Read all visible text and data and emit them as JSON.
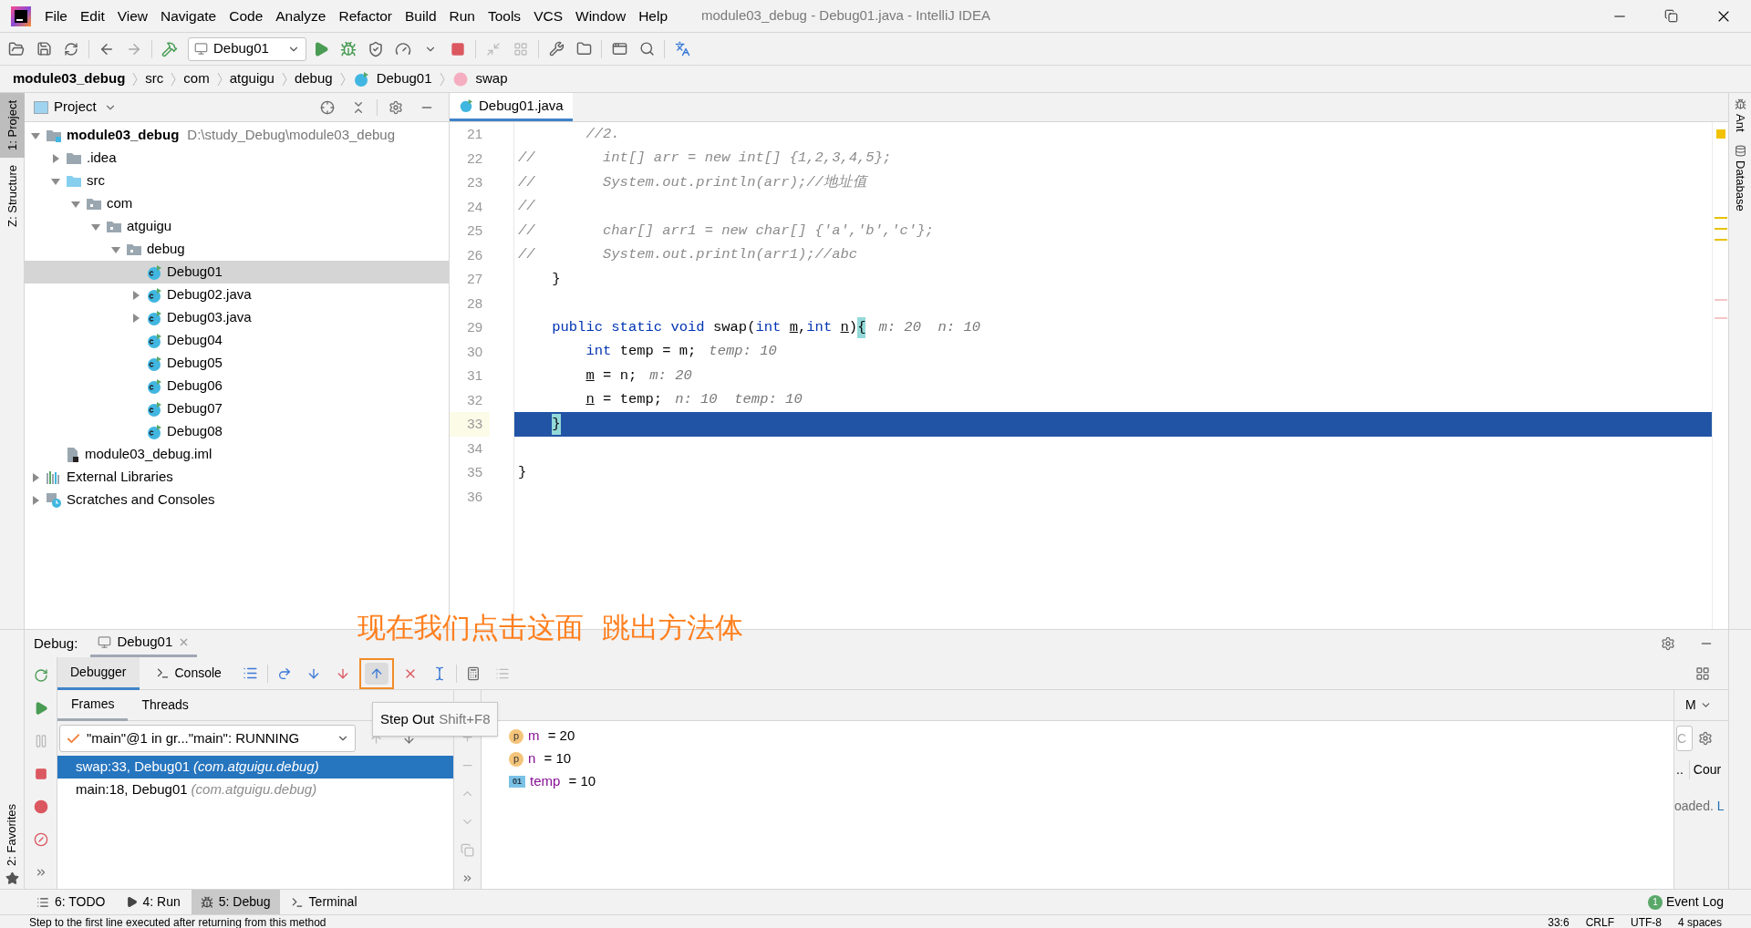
{
  "window": {
    "title": "module03_debug - Debug01.java - IntelliJ IDEA"
  },
  "menu": [
    "File",
    "Edit",
    "View",
    "Navigate",
    "Code",
    "Analyze",
    "Refactor",
    "Build",
    "Run",
    "Tools",
    "VCS",
    "Window",
    "Help"
  ],
  "toolbar": {
    "run_config": "Debug01"
  },
  "breadcrumb": [
    {
      "label": "module03_debug",
      "kind": "module"
    },
    {
      "label": "src",
      "kind": "plain"
    },
    {
      "label": "com",
      "kind": "plain"
    },
    {
      "label": "atguigu",
      "kind": "plain"
    },
    {
      "label": "debug",
      "kind": "plain"
    },
    {
      "label": "Debug01",
      "kind": "class"
    },
    {
      "label": "swap",
      "kind": "method"
    }
  ],
  "left_strip": [
    {
      "label": "1: Project",
      "selected": true
    },
    {
      "label": "Z: Structure",
      "selected": false
    }
  ],
  "project": {
    "title": "Project",
    "tree": [
      {
        "label": "module03_debug",
        "hint": "D:\\study_Debug\\module03_debug",
        "kind": "module",
        "expanded": true,
        "selected": false,
        "children": [
          {
            "label": ".idea",
            "kind": "folder",
            "expanded": false,
            "selected": false
          },
          {
            "label": "src",
            "kind": "source",
            "expanded": true,
            "selected": false,
            "children": [
              {
                "label": "com",
                "kind": "package",
                "expanded": true,
                "selected": false,
                "children": [
                  {
                    "label": "atguigu",
                    "kind": "package",
                    "expanded": true,
                    "selected": false,
                    "children": [
                      {
                        "label": "debug",
                        "kind": "package",
                        "expanded": true,
                        "selected": false,
                        "children": [
                          {
                            "label": "Debug01",
                            "kind": "class",
                            "selected": true
                          },
                          {
                            "label": "Debug02.java",
                            "kind": "class",
                            "expanded": false,
                            "selected": false
                          },
                          {
                            "label": "Debug03.java",
                            "kind": "class",
                            "expanded": false,
                            "selected": false
                          },
                          {
                            "label": "Debug04",
                            "kind": "class",
                            "selected": false
                          },
                          {
                            "label": "Debug05",
                            "kind": "class",
                            "selected": false
                          },
                          {
                            "label": "Debug06",
                            "kind": "class",
                            "selected": false
                          },
                          {
                            "label": "Debug07",
                            "kind": "class",
                            "selected": false
                          },
                          {
                            "label": "Debug08",
                            "kind": "class",
                            "selected": false
                          }
                        ]
                      }
                    ]
                  }
                ]
              }
            ]
          },
          {
            "label": "module03_debug.iml",
            "kind": "file",
            "selected": false
          }
        ]
      },
      {
        "label": "External Libraries",
        "kind": "library",
        "expanded": false,
        "selected": false
      },
      {
        "label": "Scratches and Consoles",
        "kind": "scratches",
        "expanded": false,
        "selected": false
      }
    ]
  },
  "editor": {
    "tab": "Debug01.java",
    "lines": [
      {
        "number": "21",
        "current": false,
        "tokens": [
          {
            "text": "        //2.",
            "kind": "comment"
          }
        ]
      },
      {
        "number": "22",
        "current": false,
        "tokens": [
          {
            "text": "//        int[] arr = new int[] {1,2,3,4,5};",
            "kind": "comment"
          }
        ]
      },
      {
        "number": "23",
        "current": false,
        "tokens": [
          {
            "text": "//        System.out.println(arr);//地址值",
            "kind": "comment"
          }
        ]
      },
      {
        "number": "24",
        "current": false,
        "tokens": [
          {
            "text": "//",
            "kind": "comment"
          }
        ]
      },
      {
        "number": "25",
        "current": false,
        "tokens": [
          {
            "text": "//        char[] arr1 = new char[] {'a','b','c'};",
            "kind": "comment"
          }
        ]
      },
      {
        "number": "26",
        "current": false,
        "tokens": [
          {
            "text": "//        System.out.println(arr1);//abc",
            "kind": "comment"
          }
        ]
      },
      {
        "number": "27",
        "current": false,
        "tokens": [
          {
            "text": "    }",
            "kind": "plain"
          }
        ]
      },
      {
        "number": "28",
        "current": false
      },
      {
        "number": "29",
        "current": false,
        "tokens": [
          {
            "text": "    public static void",
            "kind": "keyword"
          },
          {
            "text": " swap(",
            "kind": "plain"
          },
          {
            "text": "int ",
            "kind": "keyword"
          },
          {
            "text": "m",
            "kind": "param"
          },
          {
            "text": ",",
            "kind": "plain"
          },
          {
            "text": "int ",
            "kind": "keyword"
          },
          {
            "text": "n",
            "kind": "param"
          },
          {
            "text": ")",
            "kind": "plain"
          },
          {
            "text": "{",
            "kind": "brace"
          }
        ],
        "hint": "m: 20  n: 10"
      },
      {
        "number": "30",
        "current": false,
        "tokens": [
          {
            "text": "        int",
            "kind": "keyword"
          },
          {
            "text": " temp = m;",
            "kind": "plain"
          }
        ],
        "hint": "temp: 10"
      },
      {
        "number": "31",
        "current": false,
        "tokens": [
          {
            "text": "        m",
            "kind": "param"
          },
          {
            "text": " = n;",
            "kind": "plain"
          }
        ],
        "hint": "m: 20"
      },
      {
        "number": "32",
        "current": false,
        "tokens": [
          {
            "text": "        n",
            "kind": "param"
          },
          {
            "text": " = temp;",
            "kind": "plain"
          }
        ],
        "hint": "n: 10  temp: 10"
      },
      {
        "number": "33",
        "current": true,
        "tokens": [
          {
            "text": "    }",
            "kind": "brace"
          }
        ]
      },
      {
        "number": "34",
        "current": false
      },
      {
        "number": "35",
        "current": false,
        "tokens": [
          {
            "text": "}",
            "kind": "plain"
          }
        ]
      },
      {
        "number": "36",
        "current": false
      }
    ]
  },
  "right_strip": [
    "Ant",
    "Database"
  ],
  "debug": {
    "label": "Debug:",
    "session": "Debug01",
    "tabs": [
      {
        "label": "Debugger",
        "selected": true
      },
      {
        "label": "Console",
        "selected": false
      }
    ],
    "step_out_outlined": true,
    "subtabs": [
      {
        "label": "Frames",
        "selected": true
      },
      {
        "label": "Threads",
        "selected": false
      }
    ],
    "thread": "\"main\"@1 in gr...\"main\": RUNNING",
    "frames": [
      {
        "name": "swap:33, Debug01",
        "package": "(com.atguigu.debug)",
        "selected": true
      },
      {
        "name": "main:18, Debug01",
        "package": "(com.atguigu.debug)",
        "selected": false
      }
    ],
    "variables": [
      {
        "badge": "p",
        "kind": "param",
        "name": "m",
        "value": " = 20"
      },
      {
        "badge": "p",
        "kind": "param",
        "name": "n",
        "value": " = 10"
      },
      {
        "badge": "01",
        "kind": "local",
        "name": "temp",
        "value": " = 10"
      }
    ],
    "tooltip": {
      "title": "Step Out",
      "shortcut": "Shift+F8"
    },
    "side_panel": {
      "tab": "M",
      "field": "C",
      "column_1": "..",
      "column_2": "Cour",
      "message": "oaded.",
      "link": "L"
    }
  },
  "annotation": "现在我们点击这面  跳出方法体",
  "favorites": "2: Favorites",
  "bottom_tabs": [
    {
      "label": "6: TODO",
      "selected": false
    },
    {
      "label": "4: Run",
      "selected": false
    },
    {
      "label": "5: Debug",
      "selected": true
    },
    {
      "label": "Terminal",
      "selected": false
    }
  ],
  "event_log": {
    "label": "Event Log",
    "count": "1"
  },
  "status_bar": {
    "message": "Step to the first line executed after returning from this method",
    "position": "33:6",
    "line_ending": "CRLF",
    "encoding": "UTF-8",
    "indent": "4 spaces"
  }
}
